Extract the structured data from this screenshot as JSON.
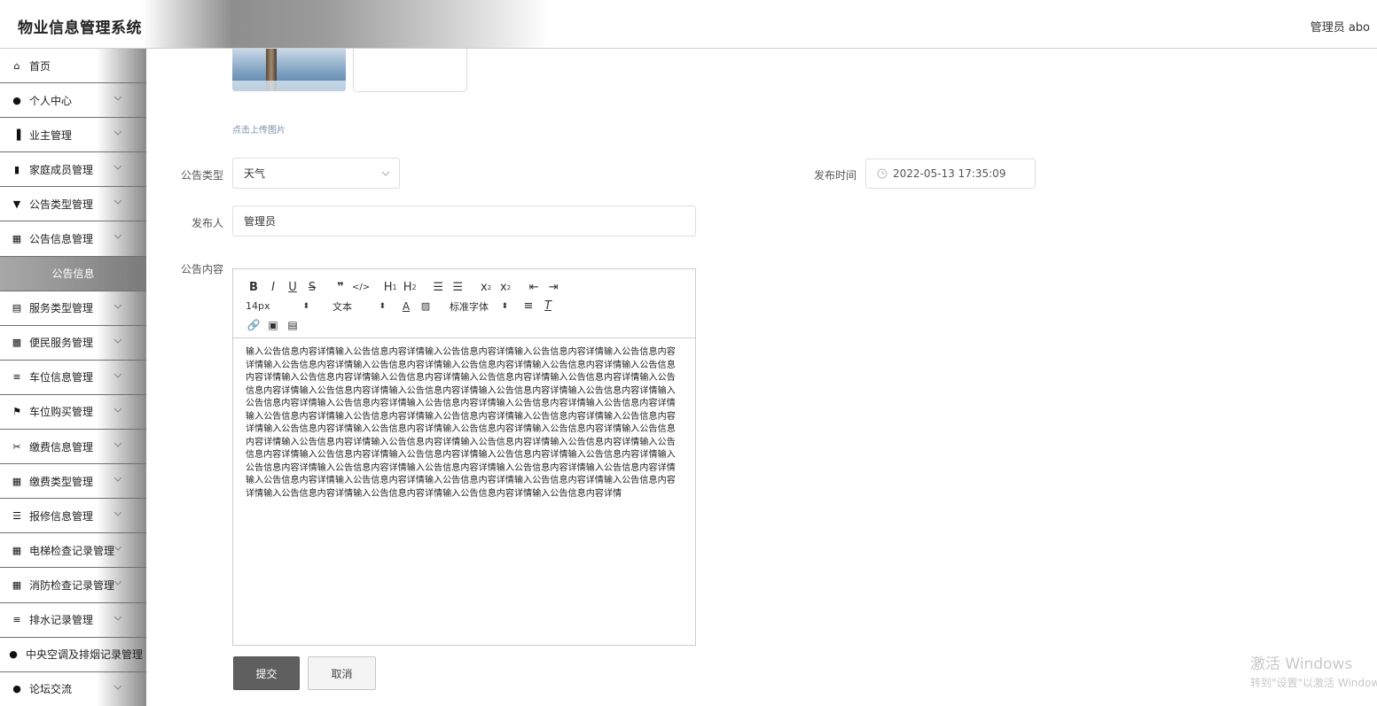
{
  "header": {
    "app_title": "物业信息管理系统",
    "user_label": "管理员 abo"
  },
  "sidebar": {
    "items": [
      {
        "label": "首页",
        "icon": "home-icon",
        "has_chevron": false,
        "active": false
      },
      {
        "label": "个人中心",
        "icon": "user-icon",
        "has_chevron": true,
        "active": false
      },
      {
        "label": "业主管理",
        "icon": "chart-columns-icon",
        "has_chevron": true,
        "active": false
      },
      {
        "label": "家庭成员管理",
        "icon": "bar-chart-icon",
        "has_chevron": true,
        "active": false
      },
      {
        "label": "公告类型管理",
        "icon": "pin-icon",
        "has_chevron": true,
        "active": false
      },
      {
        "label": "公告信息管理",
        "icon": "grid-icon",
        "has_chevron": true,
        "active": false
      },
      {
        "label": "公告信息",
        "icon": "",
        "has_chevron": false,
        "active": true
      },
      {
        "label": "服务类型管理",
        "icon": "document-icon",
        "has_chevron": true,
        "active": false
      },
      {
        "label": "便民服务管理",
        "icon": "picture-icon",
        "has_chevron": true,
        "active": false
      },
      {
        "label": "车位信息管理",
        "icon": "list-icon",
        "has_chevron": true,
        "active": false
      },
      {
        "label": "车位购买管理",
        "icon": "flag-icon",
        "has_chevron": true,
        "active": false
      },
      {
        "label": "缴费信息管理",
        "icon": "ticket-icon",
        "has_chevron": true,
        "active": false
      },
      {
        "label": "缴费类型管理",
        "icon": "grid-icon",
        "has_chevron": true,
        "active": false
      },
      {
        "label": "报修信息管理",
        "icon": "sliders-icon",
        "has_chevron": true,
        "active": false
      },
      {
        "label": "电梯检查记录管理",
        "icon": "grid-icon",
        "has_chevron": true,
        "active": false
      },
      {
        "label": "消防检查记录管理",
        "icon": "dense-grid-icon",
        "has_chevron": true,
        "active": false
      },
      {
        "label": "排水记录管理",
        "icon": "list-icon",
        "has_chevron": true,
        "active": false
      },
      {
        "label": "中央空调及排烟记录管理",
        "icon": "location-pin-icon",
        "has_chevron": false,
        "active": false
      },
      {
        "label": "论坛交流",
        "icon": "user-icon",
        "has_chevron": true,
        "active": false
      }
    ]
  },
  "form": {
    "upload_hint": "点击上传图片",
    "type_label": "公告类型",
    "type_value": "天气",
    "time_label": "发布时间",
    "time_value": "2022-05-13 17:35:09",
    "publisher_label": "发布人",
    "publisher_value": "管理员",
    "content_label": "公告内容",
    "submit_label": "提交",
    "cancel_label": "取消"
  },
  "editor": {
    "toolbar_row1": [
      "B",
      "I",
      "U",
      "S",
      "99",
      "</>",
      "H1",
      "H2",
      "ol",
      "ul",
      "x2",
      "x2",
      "indent-left",
      "indent-right"
    ],
    "size_value": "14px",
    "text_value": "文本",
    "font_value": "标准字体",
    "content": "输入公告信息内容详情输入公告信息内容详情输入公告信息内容详情输入公告信息内容详情输入公告信息内容详情输入公告信息内容详情输入公告信息内容详情输入公告信息内容详情输入公告信息内容详情输入公告信息内容详情输入公告信息内容详情输入公告信息内容详情输入公告信息内容详情输入公告信息内容详情输入公告信息内容详情输入公告信息内容详情输入公告信息内容详情输入公告信息内容详情输入公告信息内容详情输入公告信息内容详情输入公告信息内容详情输入公告信息内容详情输入公告信息内容详情输入公告信息内容详情输入公告信息内容详情输入公告信息内容详情输入公告信息内容详情输入公告信息内容详情输入公告信息内容详情输入公告信息内容详情输入公告信息内容详情输入公告信息内容详情输入公告信息内容详情输入公告信息内容详情输入公告信息内容详情输入公告信息内容详情输入公告信息内容详情输入公告信息内容详情输入公告信息内容详情输入公告信息内容详情输入公告信息内容详情输入公告信息内容详情输入公告信息内容详情输入公告信息内容详情输入公告信息内容详情输入公告信息内容详情输入公告信息内容详情输入公告信息内容详情输入公告信息内容详情输入公告信息内容详情输入公告信息内容详情输入公告信息内容详情输入公告信息内容详情输入公告信息内容详情输入公告信息内容详情输入公告信息内容详情输入公告信息内容详情"
  },
  "watermark": {
    "line1": "激活 Windows",
    "line2": "转到\"设置\"以激活 Windows。"
  }
}
